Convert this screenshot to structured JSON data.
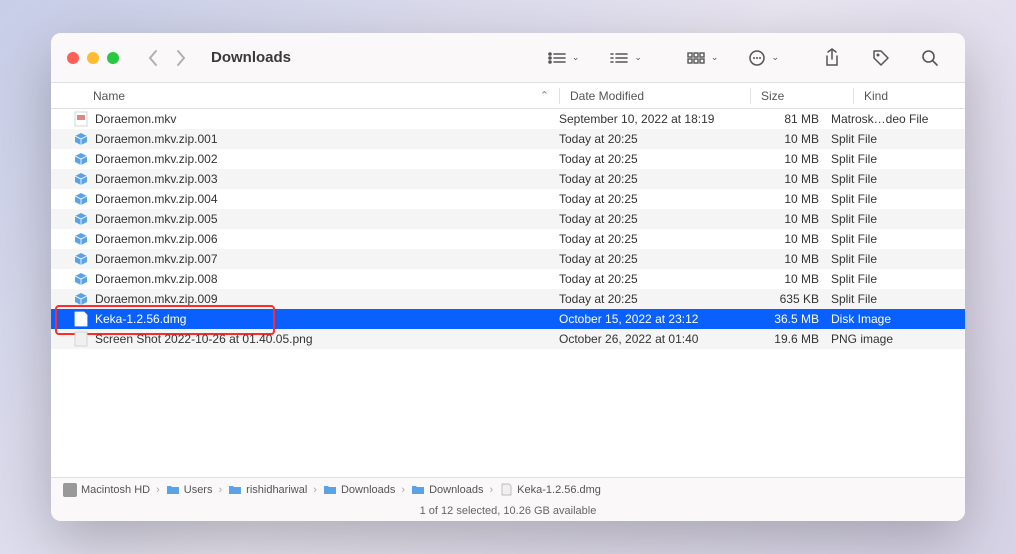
{
  "window": {
    "title": "Downloads"
  },
  "columns": {
    "name": "Name",
    "date": "Date Modified",
    "size": "Size",
    "kind": "Kind"
  },
  "files": [
    {
      "icon": "doc",
      "name": "Doraemon.mkv",
      "date": "September 10, 2022 at 18:19",
      "size": "81 MB",
      "kind": "Matrosk…deo File",
      "alt": false,
      "sel": false
    },
    {
      "icon": "box",
      "name": "Doraemon.mkv.zip.001",
      "date": "Today at 20:25",
      "size": "10 MB",
      "kind": "Split File",
      "alt": true,
      "sel": false
    },
    {
      "icon": "box",
      "name": "Doraemon.mkv.zip.002",
      "date": "Today at 20:25",
      "size": "10 MB",
      "kind": "Split File",
      "alt": false,
      "sel": false
    },
    {
      "icon": "box",
      "name": "Doraemon.mkv.zip.003",
      "date": "Today at 20:25",
      "size": "10 MB",
      "kind": "Split File",
      "alt": true,
      "sel": false
    },
    {
      "icon": "box",
      "name": "Doraemon.mkv.zip.004",
      "date": "Today at 20:25",
      "size": "10 MB",
      "kind": "Split File",
      "alt": false,
      "sel": false
    },
    {
      "icon": "box",
      "name": "Doraemon.mkv.zip.005",
      "date": "Today at 20:25",
      "size": "10 MB",
      "kind": "Split File",
      "alt": true,
      "sel": false
    },
    {
      "icon": "box",
      "name": "Doraemon.mkv.zip.006",
      "date": "Today at 20:25",
      "size": "10 MB",
      "kind": "Split File",
      "alt": false,
      "sel": false
    },
    {
      "icon": "box",
      "name": "Doraemon.mkv.zip.007",
      "date": "Today at 20:25",
      "size": "10 MB",
      "kind": "Split File",
      "alt": true,
      "sel": false
    },
    {
      "icon": "box",
      "name": "Doraemon.mkv.zip.008",
      "date": "Today at 20:25",
      "size": "10 MB",
      "kind": "Split File",
      "alt": false,
      "sel": false
    },
    {
      "icon": "box",
      "name": "Doraemon.mkv.zip.009",
      "date": "Today at 20:25",
      "size": "635 KB",
      "kind": "Split File",
      "alt": true,
      "sel": false
    },
    {
      "icon": "dmg",
      "name": "Keka-1.2.56.dmg",
      "date": "October 15, 2022 at 23:12",
      "size": "36.5 MB",
      "kind": "Disk Image",
      "alt": false,
      "sel": true,
      "hl": true
    },
    {
      "icon": "png",
      "name": "Screen Shot 2022-10-26 at 01.40.05.png",
      "date": "October 26, 2022 at 01:40",
      "size": "19.6 MB",
      "kind": "PNG image",
      "alt": true,
      "sel": false
    }
  ],
  "path": [
    {
      "icon": "hd",
      "label": "Macintosh HD"
    },
    {
      "icon": "folder",
      "label": "Users"
    },
    {
      "icon": "folder",
      "label": "rishidhariwal"
    },
    {
      "icon": "folder",
      "label": "Downloads"
    },
    {
      "icon": "folder",
      "label": "Downloads"
    },
    {
      "icon": "doc",
      "label": "Keka-1.2.56.dmg"
    }
  ],
  "status": "1 of 12 selected, 10.26 GB available"
}
